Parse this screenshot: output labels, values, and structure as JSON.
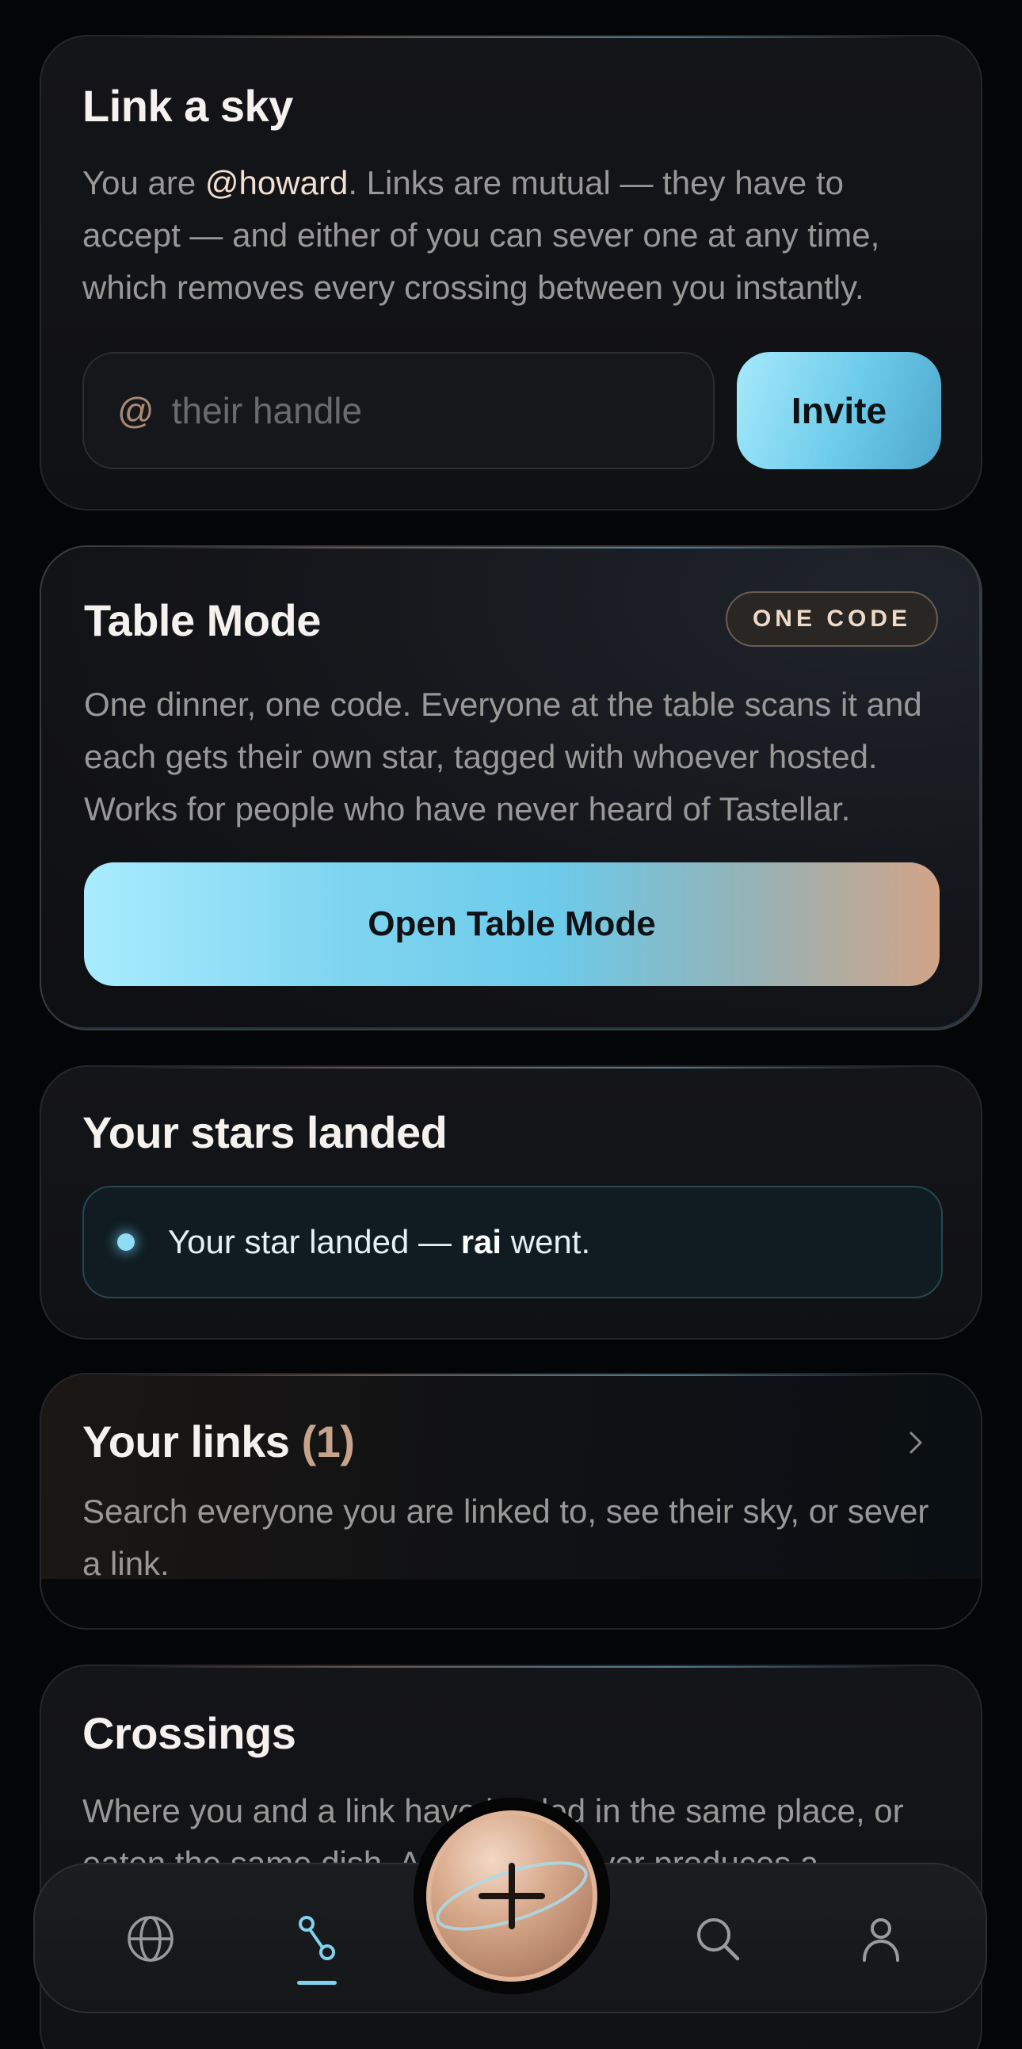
{
  "link_sky": {
    "title": "Link a sky",
    "body_prefix": "You are ",
    "handle": "@howard",
    "body_suffix": ". Links are mutual — they have to accept — and either of you can sever one at any time, which removes every crossing between you instantly.",
    "input_prefix": "@",
    "input_placeholder": "their handle",
    "input_value": "",
    "invite_label": "Invite"
  },
  "table_mode": {
    "title": "Table Mode",
    "badge": "ONE CODE",
    "body": "One dinner, one code. Everyone at the table scans it and each gets their own star, tagged with whoever hosted. Works for people who have never heard of Tastellar.",
    "button_label": "Open Table Mode"
  },
  "stars_landed": {
    "title": "Your stars landed",
    "item_prefix": "Your star landed — ",
    "item_name": "rai",
    "item_suffix": " went."
  },
  "links": {
    "title": "Your links",
    "count": "(1)",
    "body": "Search everyone you are linked to, see their sky, or sever a link."
  },
  "crossings": {
    "title": "Crossings",
    "body": "Where you and a link have landed in the same place, or eaten the same dish. A crossing never produces a"
  },
  "nav": {
    "items": [
      "globe-icon",
      "link-icon",
      "add-icon",
      "search-icon",
      "profile-icon"
    ],
    "active": "link-icon",
    "accent": "#7fd3ef"
  },
  "colors": {
    "background": "#040507",
    "accent_blue": "#6ccbea",
    "accent_copper": "#d2a488"
  }
}
